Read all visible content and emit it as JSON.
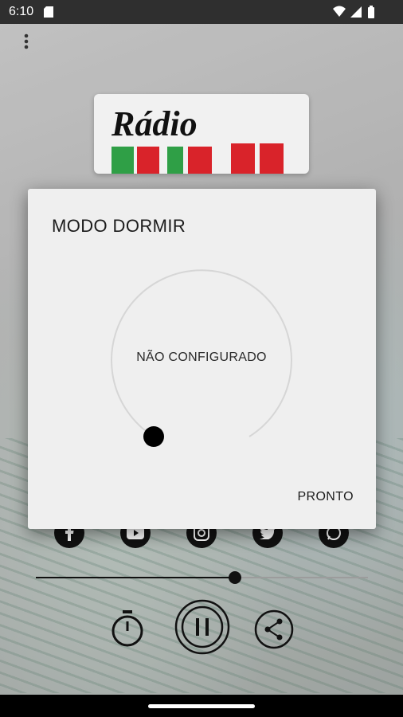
{
  "status_bar": {
    "time": "6:10",
    "icons": [
      "sd-card-icon",
      "wifi-icon",
      "cellular-signal-icon",
      "battery-icon"
    ]
  },
  "background": {
    "logo_text": "Rádio",
    "logo_brand_colors": [
      "#2f9f46",
      "#d9232a",
      "#111111"
    ],
    "social_icons": [
      "facebook-icon",
      "youtube-icon",
      "instagram-icon",
      "twitter-icon",
      "whatsapp-icon"
    ],
    "progress_fraction": 0.6,
    "controls": [
      "sleep-timer-icon",
      "pause-icon",
      "share-icon"
    ]
  },
  "dialog": {
    "title": "MODO DORMIR",
    "status_text": "NÃO CONFIGURADO",
    "done_button": "PRONTO",
    "dial_value_fraction": 0
  },
  "colors": {
    "dialog_bg": "#efefef",
    "text": "#1b1b1b",
    "dial_track": "#d6d6d6",
    "dial_thumb": "#000000"
  }
}
